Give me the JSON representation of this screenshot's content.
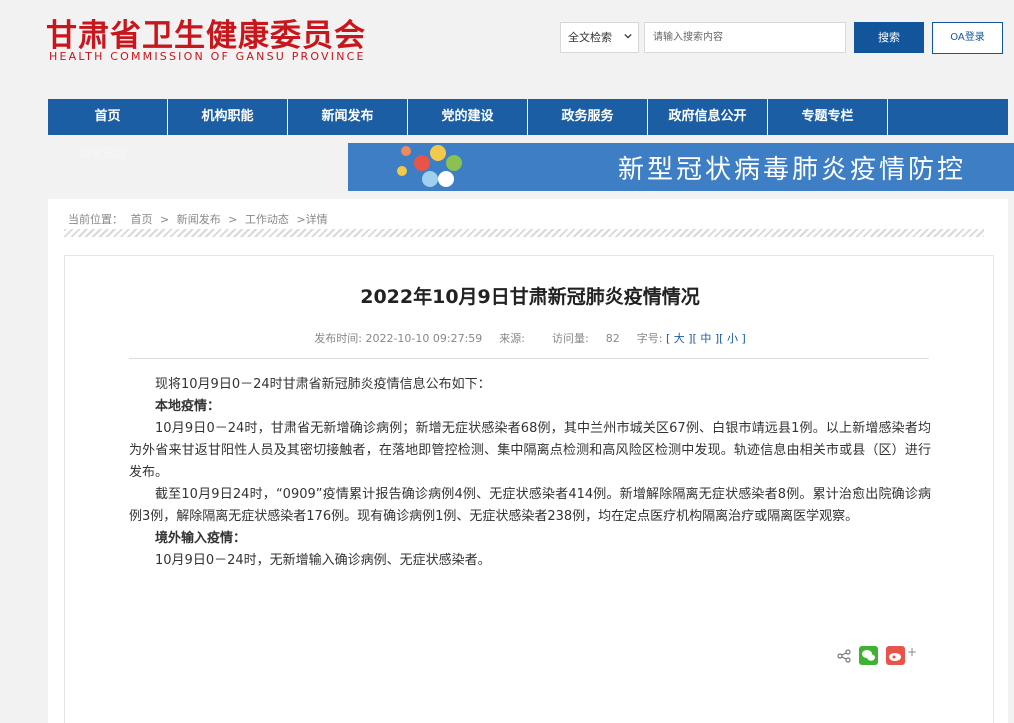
{
  "header": {
    "logo_cn": "甘肃省卫生健康委员会",
    "logo_en": "HEALTH COMMISSION OF GANSU PROVINCE",
    "search_select": "全文检索",
    "search_placeholder": "请输入搜索内容",
    "search_button": "搜索",
    "oa_button": "OA登录"
  },
  "nav": {
    "items": [
      "首页",
      "机构职能",
      "新闻发布",
      "党的建设",
      "政务服务",
      "政府信息公开",
      "专题专栏",
      ""
    ],
    "sub_item": "深化医改"
  },
  "banner": {
    "text": "新型冠状病毒肺炎疫情防控"
  },
  "breadcrumb": {
    "label": "当前位置：",
    "items": [
      "首页",
      ">",
      "新闻发布",
      ">",
      "工作动态",
      ">详情"
    ]
  },
  "article": {
    "title": "2022年10月9日甘肃新冠肺炎疫情情况",
    "publish_label": "发布时间:",
    "publish_time": "2022-10-10 09:27:59",
    "source_label": "来源:",
    "views_label": "访问量:",
    "views": "82",
    "font_label": "字号:",
    "font_large": "大",
    "font_medium": "中",
    "font_small": "小",
    "paragraphs": [
      "现将10月9日0－24时甘肃省新冠肺炎疫情信息公布如下：",
      "本地疫情：",
      "10月9日0－24时，甘肃省无新增确诊病例；新增无症状感染者68例，其中兰州市城关区67例、白银市靖远县1例。以上新增感染者均为外省来甘返甘阳性人员及其密切接触者，在落地即管控检测、集中隔离点检测和高风险区检测中发现。轨迹信息由相关市或县（区）进行发布。",
      "截至10月9日24时，“0909”疫情累计报告确诊病例4例、无症状感染者414例。新增解除隔离无症状感染者8例。累计治愈出院确诊病例3例，解除隔离无症状感染者176例。现有确诊病例1例、无症状感染者238例，均在定点医疗机构隔离治疗或隔离医学观察。",
      "境外输入疫情：",
      "10月9日0－24时，无新增输入确诊病例、无症状感染者。"
    ]
  },
  "colors": {
    "brand_red": "#c8161d",
    "nav_blue": "#1b5ea3",
    "search_blue": "#13559b"
  }
}
